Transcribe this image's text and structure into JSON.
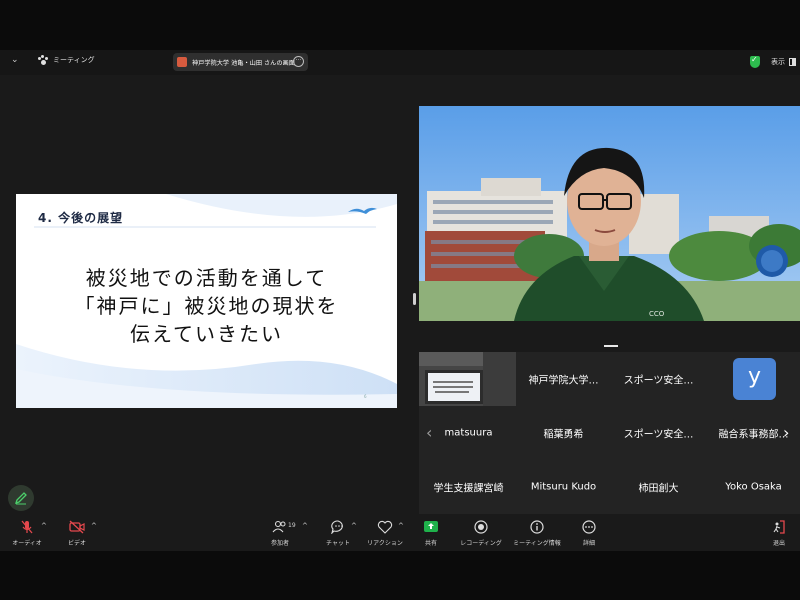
{
  "titlebar": {
    "chevron": "⌄",
    "meeting_label": "ミーティング",
    "tab_title": "神戸学院大学 池亀・山田 さんの画面",
    "tab_more": "···",
    "view_label": "表示"
  },
  "slide": {
    "title": "4. 今後の展望",
    "body_lines": [
      "被災地での活動を通して",
      "「神戸に」被災地の現状を",
      "伝えていきたい"
    ],
    "page_number": "6"
  },
  "participants": [
    {
      "name": "",
      "type": "thumbnail"
    },
    {
      "name": "神戸学院大学…"
    },
    {
      "name": "スポーツ安全…"
    },
    {
      "name": "",
      "avatar": "y"
    },
    {
      "name": "matsuura"
    },
    {
      "name": "稲葉勇希"
    },
    {
      "name": "スポーツ安全…"
    },
    {
      "name": "融合系事務部…"
    },
    {
      "name": "学生支援課宮崎"
    },
    {
      "name": "Mitsuru Kudo"
    },
    {
      "name": "柿田創大"
    },
    {
      "name": "Yoko Osaka"
    }
  ],
  "toolbar": {
    "audio": "オーディオ",
    "video": "ビデオ",
    "participants": "参加者",
    "participants_count": "19",
    "chat": "チャット",
    "reactions": "リアクション",
    "share": "共有",
    "record": "レコーディング",
    "info": "ミーティング情報",
    "more": "詳細",
    "leave": "退出"
  },
  "colors": {
    "share_green": "#1fb14b",
    "mute_red": "#e5484d",
    "leave_red": "#e5484d",
    "avatar_blue": "#4a83d4"
  }
}
